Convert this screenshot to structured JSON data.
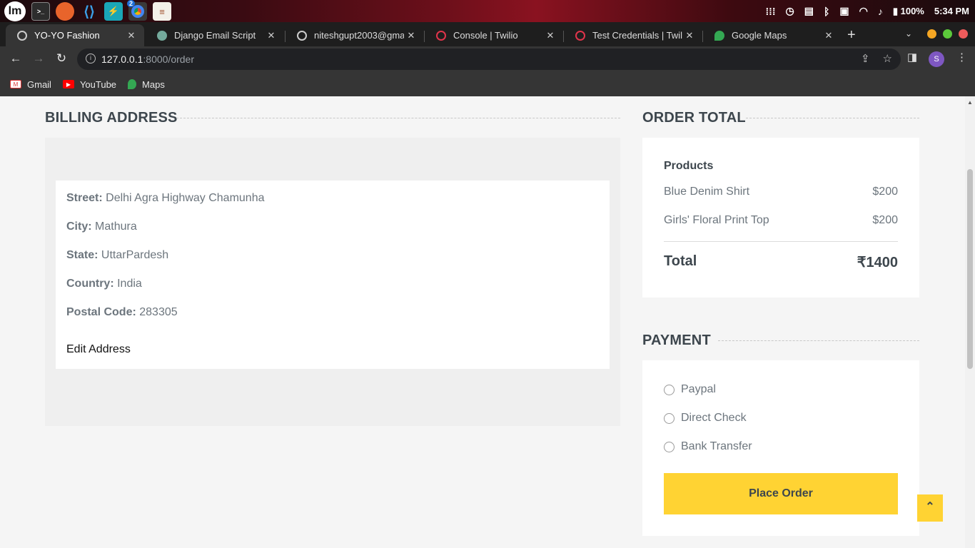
{
  "os_panel": {
    "logo": "lm",
    "battery": "100%",
    "time": "5:34 PM",
    "chrome_badge": "2"
  },
  "tabs": [
    {
      "title": "YO-YO Fashion",
      "active": true
    },
    {
      "title": "Django Email Script",
      "active": false
    },
    {
      "title": "niteshgupt2003@gmai",
      "active": false
    },
    {
      "title": "Console | Twilio",
      "active": false
    },
    {
      "title": "Test Credentials | Twili",
      "active": false
    },
    {
      "title": "Google Maps",
      "active": false
    }
  ],
  "address_bar": {
    "host": "127.0.0.1",
    "path": ":8000/order",
    "profile_initial": "S"
  },
  "bookmarks": [
    {
      "label": "Gmail"
    },
    {
      "label": "YouTube"
    },
    {
      "label": "Maps"
    }
  ],
  "billing": {
    "title": "BILLING ADDRESS",
    "street_label": "Street:",
    "street": "Delhi Agra Highway Chamunha",
    "city_label": "City:",
    "city": "Mathura",
    "state_label": "State:",
    "state": "UttarPardesh",
    "country_label": "Country:",
    "country": "India",
    "postal_label": "Postal Code:",
    "postal": "283305",
    "edit_label": "Edit Address"
  },
  "order_total": {
    "title": "ORDER TOTAL",
    "products_heading": "Products",
    "products": [
      {
        "name": "Blue Denim Shirt",
        "price": "$200"
      },
      {
        "name": "Girls' Floral Print Top",
        "price": "$200"
      }
    ],
    "total_label": "Total",
    "total_value": "₹1400"
  },
  "payment": {
    "title": "PAYMENT",
    "options": [
      "Paypal",
      "Direct Check",
      "Bank Transfer"
    ],
    "place_order_label": "Place Order"
  },
  "back_to_top_icon": "double-chevron-up-icon",
  "colors": {
    "accent": "#ffd333",
    "heading": "#3d464d",
    "muted_text": "#6c757d"
  }
}
